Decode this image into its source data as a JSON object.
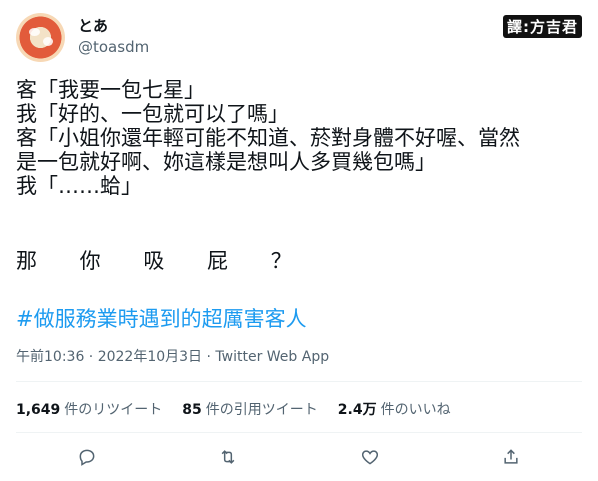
{
  "user": {
    "name": "とあ",
    "handle": "@toasdm"
  },
  "watermark": "譯:方吉君",
  "tweet": {
    "lines": "客「我要一包七星」\n我「好的、一包就可以了嗎」\n客「小姐你還年輕可能不知道、菸對身體不好喔、當然\n是一包就好啊、妳這樣是想叫人多買幾包嗎」\n我「……蛤」",
    "spaced_line": "那 你 吸 屁 ？",
    "hashtag": "#做服務業時遇到的超厲害客人"
  },
  "meta": "午前10:36 · 2022年10月3日 · Twitter Web App",
  "stats": {
    "retweets": {
      "num": "1,649",
      "label": "件のリツイート"
    },
    "quotes": {
      "num": "85",
      "label": "件の引用ツイート"
    },
    "likes": {
      "num": "2.4万",
      "label": "件のいいね"
    }
  },
  "icons": [
    "reply-icon",
    "retweet-icon",
    "like-icon",
    "share-icon"
  ]
}
